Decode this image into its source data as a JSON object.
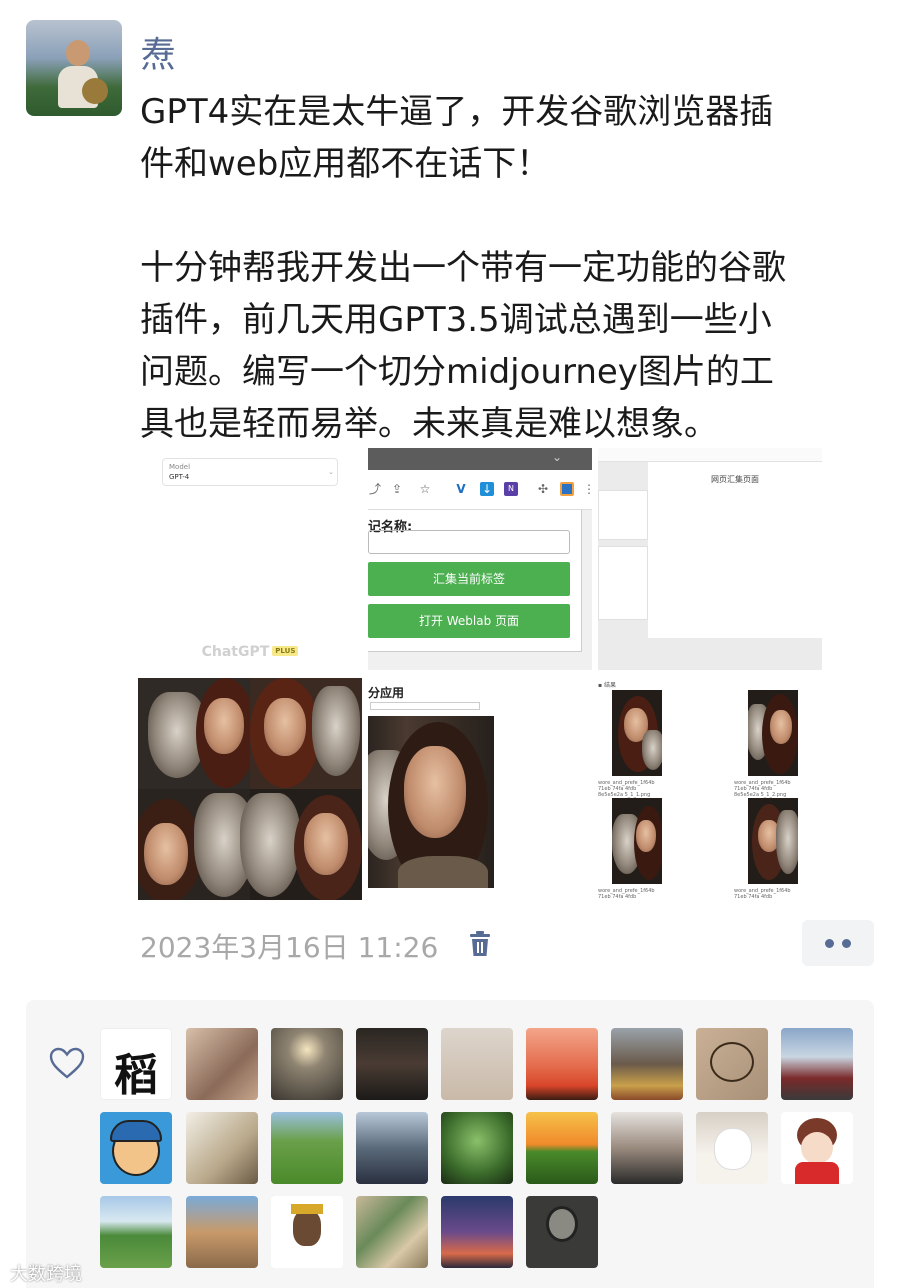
{
  "post": {
    "username": "焘",
    "text": "GPT4实在是太牛逼了，开发谷歌浏览器插\n件和web应用都不在话下！\n\n十分钟帮我开发出一个带有一定功能的谷歌\n插件，前几天用GPT3.5调试总遇到一些小\n问题。编写一个切分midjourney图片的工\n具也是轻而易举。未来真是难以想象。",
    "timestamp": "2023年3月16日 11:26"
  },
  "images": {
    "chatgpt": {
      "model_label": "Model",
      "model_value": "GPT-4",
      "brand": "ChatGPT",
      "plan": "PLUS"
    },
    "extension": {
      "name_label": "记名称:",
      "button_1": "汇集当前标签",
      "button_2": "打开 Weblab 页面"
    },
    "webpage": {
      "title": "网页汇集页面"
    },
    "splitter": {
      "title": "分应用"
    }
  },
  "likes": {
    "icon": "heart-outline-icon",
    "first_avatar_char": "稻"
  },
  "watermark": "大数跨境",
  "colors": {
    "name_link": "#576b95",
    "timestamp": "#a8a8a8",
    "likes_bg": "#f6f6f6",
    "green_button": "#4caf50"
  }
}
